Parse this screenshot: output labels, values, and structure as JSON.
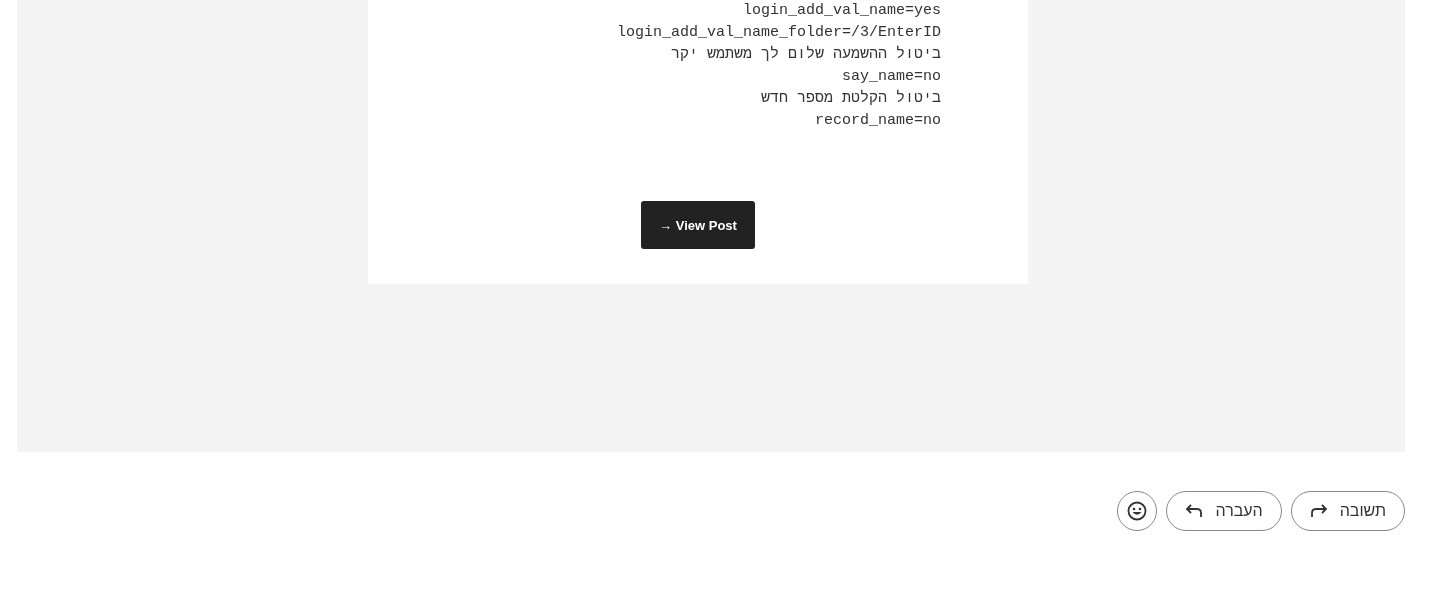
{
  "post": {
    "code_lines": [
      "login_add_val_name=yes",
      "login_add_val_name_folder=/3/EnterID",
      "ביטול ההשמעה שלום לך משתמש יקר",
      "say_name=no",
      "ביטול הקלטת מספר חדש",
      "record_name=no"
    ],
    "button": "→ View Post"
  },
  "actions": [
    {
      "kind": "reply",
      "label": "תשובה"
    },
    {
      "kind": "forward",
      "label": "העברה"
    },
    {
      "kind": "emoji"
    }
  ]
}
